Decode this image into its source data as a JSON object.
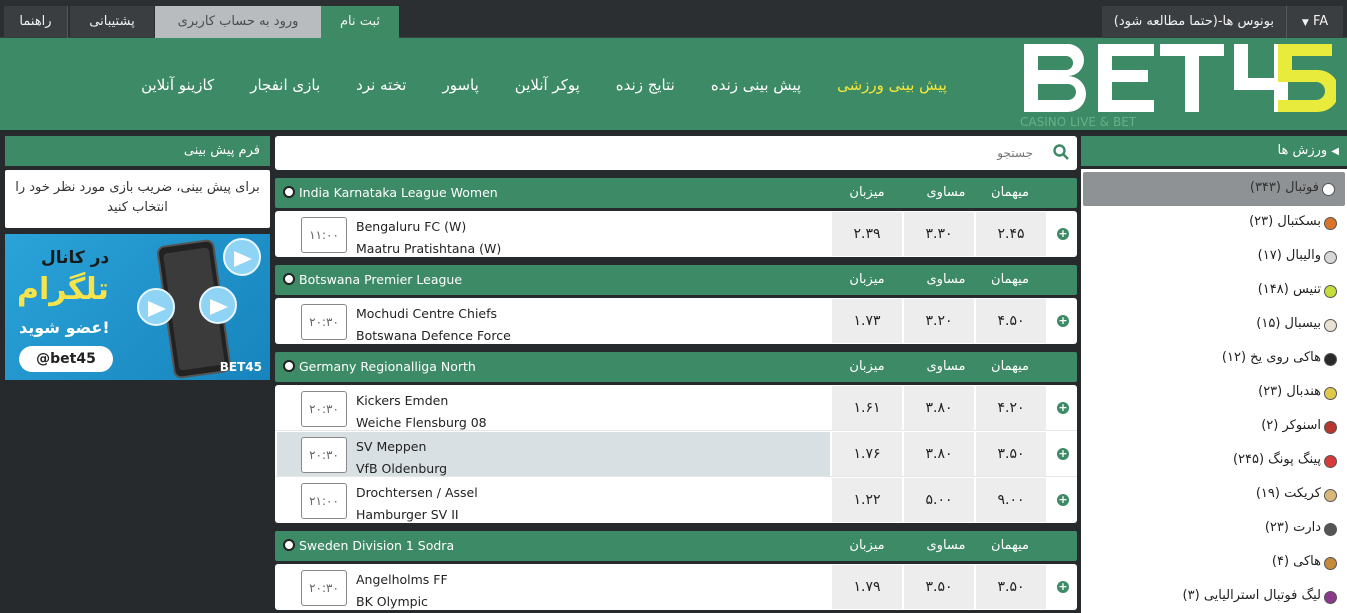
{
  "topbar": {
    "help": "راهنما",
    "support": "پشتیبانی",
    "login": "ورود به حساب کاربری",
    "register": "ثبت نام",
    "bonus": "بونوس ها-(حتما مطالعه شود)",
    "lang": "FA"
  },
  "logo": {
    "text": "BET45",
    "tagline": "CASINO LIVE & BET"
  },
  "nav": [
    {
      "label": "پیش بینی ورزشی",
      "active": true
    },
    {
      "label": "پیش بینی زنده"
    },
    {
      "label": "نتایج زنده"
    },
    {
      "label": "پوکر آنلاین"
    },
    {
      "label": "پاسور"
    },
    {
      "label": "تخته نرد"
    },
    {
      "label": "بازی انفجار"
    },
    {
      "label": "کازینو آنلاین"
    }
  ],
  "form": {
    "title": "فرم پیش بینی",
    "hint": "برای پیش بینی، ضریب بازی مورد نظر خود را انتخاب کنید"
  },
  "banner": {
    "line1": "در کانال",
    "line2": "تلگرام",
    "line3": "عضو شوید!",
    "handle": "@bet45",
    "brand": "BET45"
  },
  "search": {
    "placeholder": "جستجو"
  },
  "columns": {
    "guest": "میهمان",
    "draw": "مساوی",
    "host": "میزبان"
  },
  "leagues": [
    {
      "name": "India Karnataka League Women",
      "matches": [
        {
          "time": "۱۱:۰۰",
          "team1": "Bengaluru FC (W)",
          "team2": "Maatru Pratishtana (W)",
          "host": "۲.۳۹",
          "draw": "۳.۳۰",
          "guest": "۲.۴۵"
        }
      ]
    },
    {
      "name": "Botswana Premier League",
      "matches": [
        {
          "time": "۲۰:۳۰",
          "team1": "Mochudi Centre Chiefs",
          "team2": "Botswana Defence Force",
          "host": "۱.۷۳",
          "draw": "۳.۲۰",
          "guest": "۴.۵۰"
        }
      ]
    },
    {
      "name": "Germany Regionalliga North",
      "matches": [
        {
          "time": "۲۰:۳۰",
          "team1": "Kickers Emden",
          "team2": "Weiche Flensburg 08",
          "host": "۱.۶۱",
          "draw": "۳.۸۰",
          "guest": "۴.۲۰"
        },
        {
          "time": "۲۰:۳۰",
          "team1": "SV Meppen",
          "team2": "VfB Oldenburg",
          "host": "۱.۷۶",
          "draw": "۳.۸۰",
          "guest": "۳.۵۰",
          "highlight": true
        },
        {
          "time": "۲۱:۰۰",
          "team1": "Drochtersen / Assel",
          "team2": "Hamburger SV II",
          "host": "۱.۲۲",
          "draw": "۵.۰۰",
          "guest": "۹.۰۰"
        }
      ]
    },
    {
      "name": "Sweden Division 1 Sodra",
      "matches": [
        {
          "time": "۲۰:۳۰",
          "team1": "Angelholms FF",
          "team2": "BK Olympic",
          "host": "۱.۷۹",
          "draw": "۳.۵۰",
          "guest": "۳.۵۰"
        }
      ]
    }
  ],
  "sports": {
    "title": "ورزش ها",
    "items": [
      {
        "label": "فوتبال (۳۴۳)",
        "icon": "soccer-ball-icon",
        "color": "#ffffff",
        "active": true
      },
      {
        "label": "بسکتبال (۲۳)",
        "icon": "basketball-icon",
        "color": "#d9742b"
      },
      {
        "label": "والیبال (۱۷)",
        "icon": "volleyball-icon",
        "color": "#d7d7d7"
      },
      {
        "label": "تنیس (۱۴۸)",
        "icon": "tennis-ball-icon",
        "color": "#c6dc3b"
      },
      {
        "label": "بیسبال (۱۵)",
        "icon": "baseball-icon",
        "color": "#e8e2d2"
      },
      {
        "label": "هاکی روی یخ (۱۲)",
        "icon": "hockey-puck-icon",
        "color": "#2a2a2a"
      },
      {
        "label": "هندبال (۲۳)",
        "icon": "handball-icon",
        "color": "#e0c94a"
      },
      {
        "label": "اسنوکر (۲)",
        "icon": "snooker-icon",
        "color": "#b8372f"
      },
      {
        "label": "پینگ پونگ (۲۴۵)",
        "icon": "ping-pong-icon",
        "color": "#d83a3a"
      },
      {
        "label": "کریکت (۱۹)",
        "icon": "cricket-icon",
        "color": "#d9b77a"
      },
      {
        "label": "دارت (۲۳)",
        "icon": "dart-board-icon",
        "color": "#555555"
      },
      {
        "label": "هاکی (۴)",
        "icon": "hockey-stick-icon",
        "color": "#c58a3b"
      },
      {
        "label": "لیگ فوتبال استرالیایی (۳)",
        "icon": "aussie-rules-icon",
        "color": "#8b3a8b"
      }
    ]
  }
}
